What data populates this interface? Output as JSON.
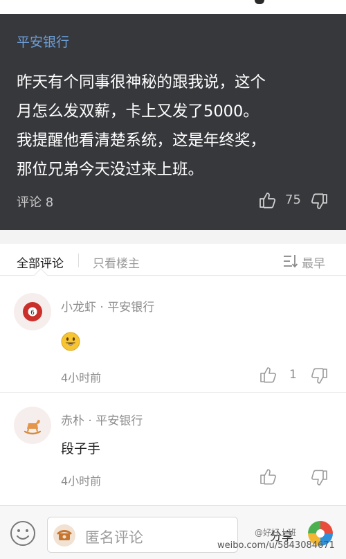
{
  "post": {
    "company": "平安银行",
    "lines": [
      "昨天有个同事很神秘的跟我说，这个",
      "月怎么发双薪，卡上又发了5000。",
      "我提醒他看清楚系统，这是年终奖，",
      "那位兄弟今天没过来上班。"
    ],
    "comments_label": "评论 8",
    "like_count": "75"
  },
  "tabs": {
    "all": "全部评论",
    "op_only": "只看楼主",
    "sort": "最早"
  },
  "comments": [
    {
      "name": "小龙虾 · 平安银行",
      "content": "",
      "emoji": "grinning-face-emoji",
      "time": "4小时前",
      "likes": "1"
    },
    {
      "name": "赤朴 · 平安银行",
      "content": "段子手",
      "time": "4小时前"
    }
  ],
  "bottom_bar": {
    "placeholder": "匿名评论",
    "share": "分享"
  },
  "watermark": {
    "top": "@好好上班",
    "url": "weibo.com/u/5843084671"
  },
  "colors": {
    "post_bg": "#37383c",
    "company_blue": "#6d9fd8",
    "tab_gray": "#999999"
  }
}
